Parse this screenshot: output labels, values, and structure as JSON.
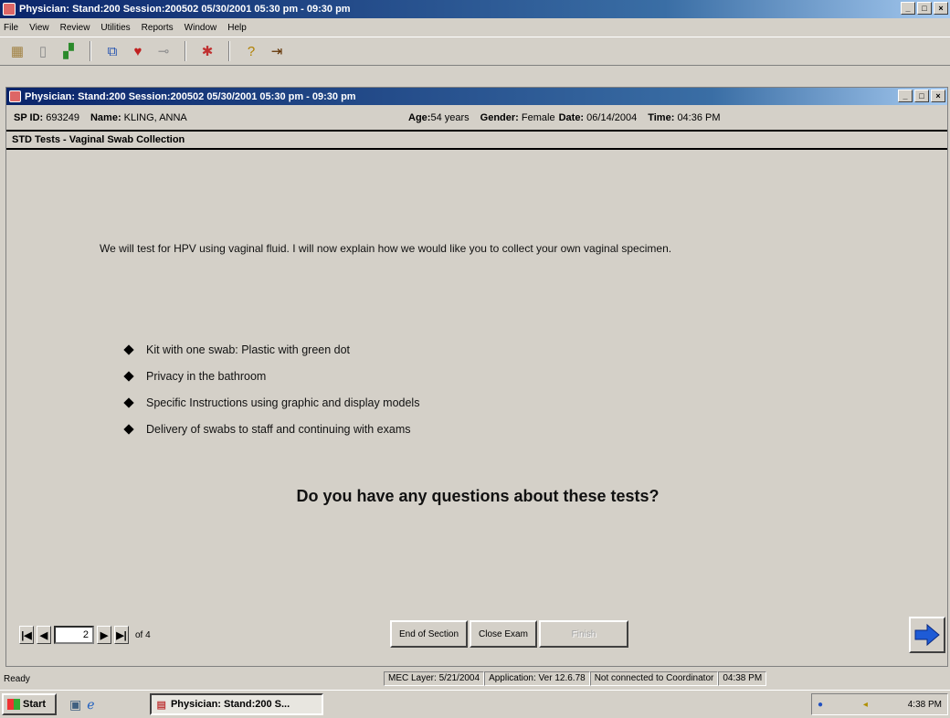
{
  "app": {
    "title": "Physician: Stand:200 Session:200502 05/30/2001 05:30 pm - 09:30 pm",
    "menu": [
      "File",
      "View",
      "Review",
      "Utilities",
      "Reports",
      "Window",
      "Help"
    ]
  },
  "child_window": {
    "title": "Physician: Stand:200 Session:200502 05/30/2001 05:30 pm - 09:30 pm"
  },
  "patient": {
    "sp_id_label": "SP ID:",
    "sp_id": "693249",
    "name_label": "Name:",
    "name": "KLING, ANNA",
    "age_label": "Age:",
    "age": "54 years",
    "gender_label": "Gender:",
    "gender": "Female",
    "date_label": "Date:",
    "date": "06/14/2004",
    "time_label": "Time:",
    "time": "04:36 PM"
  },
  "section": {
    "title": "STD Tests - Vaginal Swab Collection"
  },
  "content": {
    "intro": "We will test for HPV using vaginal fluid.  I will now explain how we would like you to collect your own vaginal specimen.",
    "bullets": [
      "Kit with one swab: Plastic with green dot",
      "Privacy in the bathroom",
      "Specific Instructions using graphic and display models",
      "Delivery of swabs to staff and continuing with exams"
    ],
    "question": "Do you have any questions about these tests?"
  },
  "navigation": {
    "page": "2",
    "of_label": "of 4",
    "end_section": "End of Section",
    "close_exam": "Close Exam",
    "finish": "Finish"
  },
  "status": {
    "ready": "Ready",
    "mec_layer": "MEC Layer: 5/21/2004",
    "app_version": "Application: Ver 12.6.78",
    "coordinator": "Not connected to Coordinator",
    "time": "04:38 PM"
  },
  "taskbar": {
    "start": "Start",
    "task": "Physician: Stand:200 S...",
    "clock": "4:38 PM"
  },
  "colors": {
    "titlebar": "#0a246a",
    "face": "#d4d0c8",
    "next_arrow": "#1e5bd6"
  }
}
